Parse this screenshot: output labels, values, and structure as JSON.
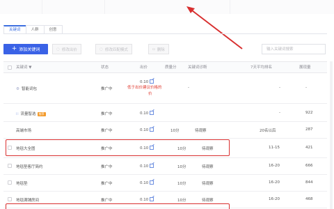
{
  "tabs": [
    {
      "label": "关键词"
    },
    {
      "label": "人群"
    },
    {
      "label": "创意"
    }
  ],
  "toolbar": {
    "add_label": "添加关键词",
    "btn_edit_bid": "修改出价",
    "btn_match": "修改匹配模式",
    "btn_delete": "删除",
    "search_placeholder": "输入关键词搜索"
  },
  "table": {
    "headers": {
      "keyword": "关键词 ▼",
      "status": "状态",
      "bid": "出价",
      "quality": "质量分",
      "match": "关键词诊断",
      "rank": "7天平均排名",
      "impressions": "展现量"
    },
    "rows": [
      {
        "keyword": "智能词包",
        "status": "推广中",
        "bid": "0.10",
        "warn": "低于出价建议价格的",
        "warn2": "价",
        "quality": "",
        "match": "-",
        "rank": "-",
        "impressions": "-"
      },
      {
        "keyword": "流量智选",
        "tag": "推荐",
        "status": "推广中",
        "bid": "0.10",
        "quality": "",
        "match": "",
        "rank": "-",
        "impressions": "922"
      },
      {
        "keyword": "高端市场",
        "status": "推广中",
        "bid": "0.10",
        "quality": "10分",
        "match": "待观察",
        "rank": "20名以后",
        "impressions": "287"
      },
      {
        "keyword": "地毯大全图",
        "status": "推广中",
        "bid": "0.10",
        "quality": "10分",
        "match": "待观察",
        "rank": "11-15",
        "impressions": "421"
      },
      {
        "keyword": "地毯垫客厅简约",
        "status": "推广中",
        "bid": "0.10",
        "quality": "10分",
        "match": "待观察",
        "rank": "16-20",
        "impressions": "666"
      },
      {
        "keyword": "地毯垫",
        "status": "推广中",
        "bid": "0.10",
        "quality": "10分",
        "match": "待观察",
        "rank": "16-20",
        "impressions": "844"
      },
      {
        "keyword": "地毯满铺房间",
        "status": "推广中",
        "bid": "0.10",
        "quality": "10分",
        "match": "待观察",
        "rank": "16-20",
        "impressions": "468"
      }
    ]
  },
  "colors": {
    "accent": "#3a62e6",
    "highlight": "#d82f2f",
    "warning": "#e03c31"
  }
}
